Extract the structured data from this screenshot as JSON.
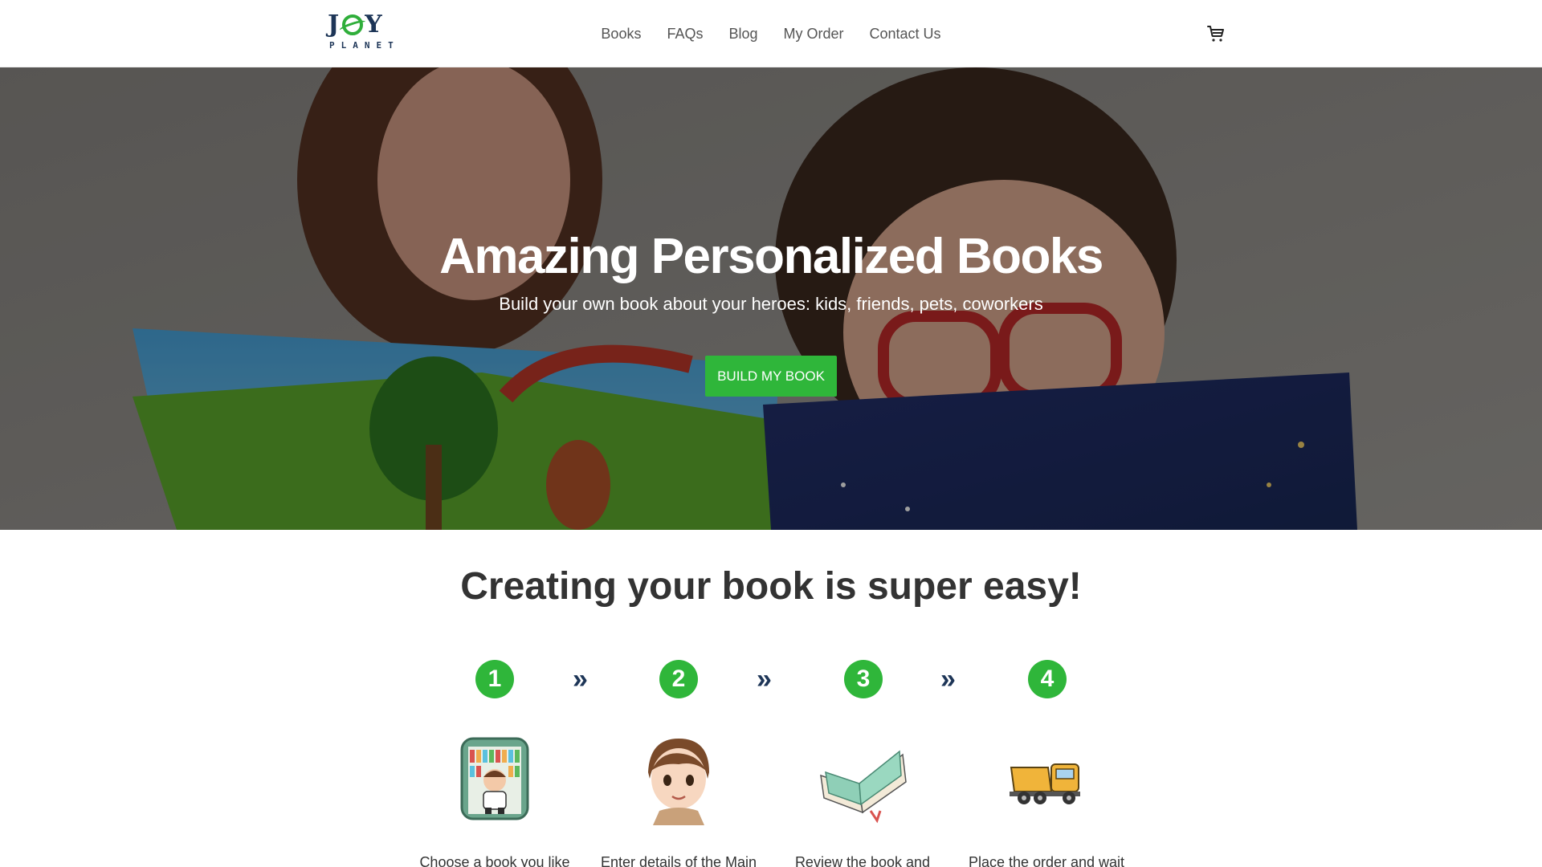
{
  "header": {
    "logo_top": "JOY",
    "logo_bottom": "PLANET",
    "nav": [
      {
        "label": "Books"
      },
      {
        "label": "FAQs"
      },
      {
        "label": "Blog"
      },
      {
        "label": "My Order"
      },
      {
        "label": "Contact Us"
      }
    ],
    "cart_icon": "shopping-cart-icon"
  },
  "hero": {
    "title": "Amazing Personalized Books",
    "subtitle": "Build your own book about your heroes: kids, friends, pets, coworkers",
    "button_label": "BUILD MY BOOK",
    "button_color": "#2fb63a"
  },
  "steps_section": {
    "title": "Creating your book is super easy!",
    "steps": [
      {
        "number": "1",
        "icon": "bookshelf-kid-icon",
        "text": "Choose a book you like"
      },
      {
        "number": "2",
        "icon": "boy-face-icon",
        "text": "Enter details of the Main"
      },
      {
        "number": "3",
        "icon": "open-book-icon",
        "text": "Review the book and"
      },
      {
        "number": "4",
        "icon": "delivery-truck-icon",
        "text": "Place the order and wait"
      }
    ],
    "arrow": "»"
  },
  "colors": {
    "accent": "#2fb63a",
    "brand_dark": "#1d3557"
  }
}
